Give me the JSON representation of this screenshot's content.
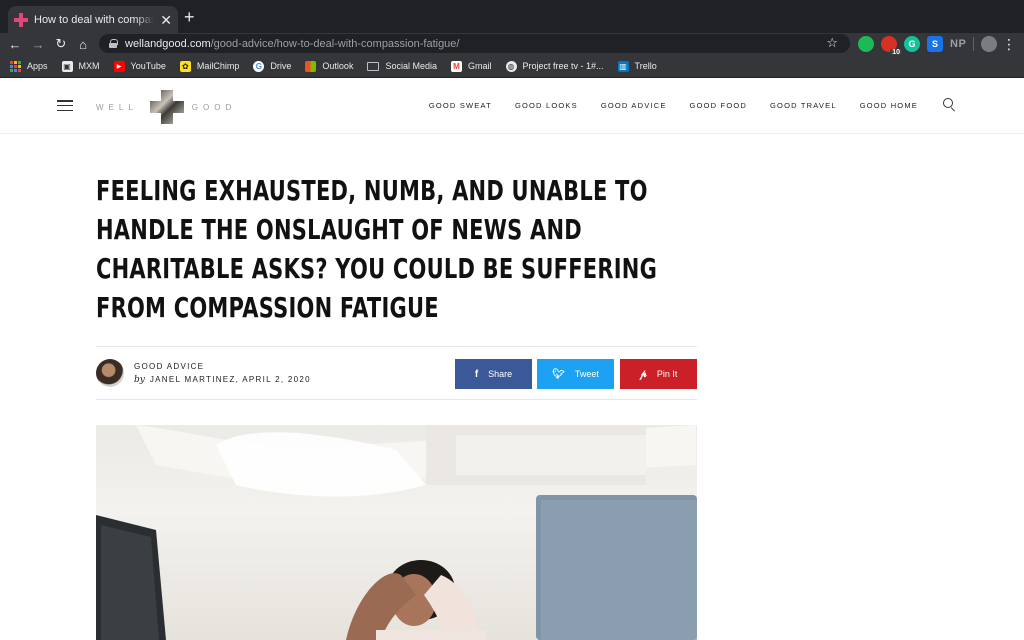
{
  "browser": {
    "tab_title": "How to deal with compassion fatigue",
    "url_host": "wellandgood.com",
    "url_path": "/good-advice/how-to-deal-with-compassion-fatigue/",
    "extensions": {
      "badge_count": "10",
      "grammarly_letter": "G",
      "s_letter": "S",
      "np_text": "NP"
    },
    "bookmarks": [
      "Apps",
      "MXM",
      "YouTube",
      "MailChimp",
      "Drive",
      "Outlook",
      "Social Media",
      "Gmail",
      "Project free tv - 1#...",
      "Trello"
    ]
  },
  "site": {
    "logo_left": "WELL",
    "logo_right": "GOOD",
    "nav": [
      "GOOD SWEAT",
      "GOOD LOOKS",
      "GOOD ADVICE",
      "GOOD FOOD",
      "GOOD TRAVEL",
      "GOOD HOME"
    ]
  },
  "article": {
    "headline_lines": [
      "FEELING EXHAUSTED, NUMB, AND UNABLE TO",
      "HANDLE THE ONSLAUGHT OF NEWS AND",
      "CHARITABLE ASKS? YOU COULD BE SUFFERING",
      "FROM COMPASSION FATIGUE"
    ],
    "category": "GOOD ADVICE",
    "by": "by",
    "author_date": "JANEL MARTINEZ, APRIL 2, 2020",
    "share": {
      "facebook": "Share",
      "twitter": "Tweet",
      "pinterest": "Pin It"
    }
  },
  "colors": {
    "facebook": "#3b5998",
    "twitter": "#1da1f2",
    "pinterest": "#cb2027"
  }
}
